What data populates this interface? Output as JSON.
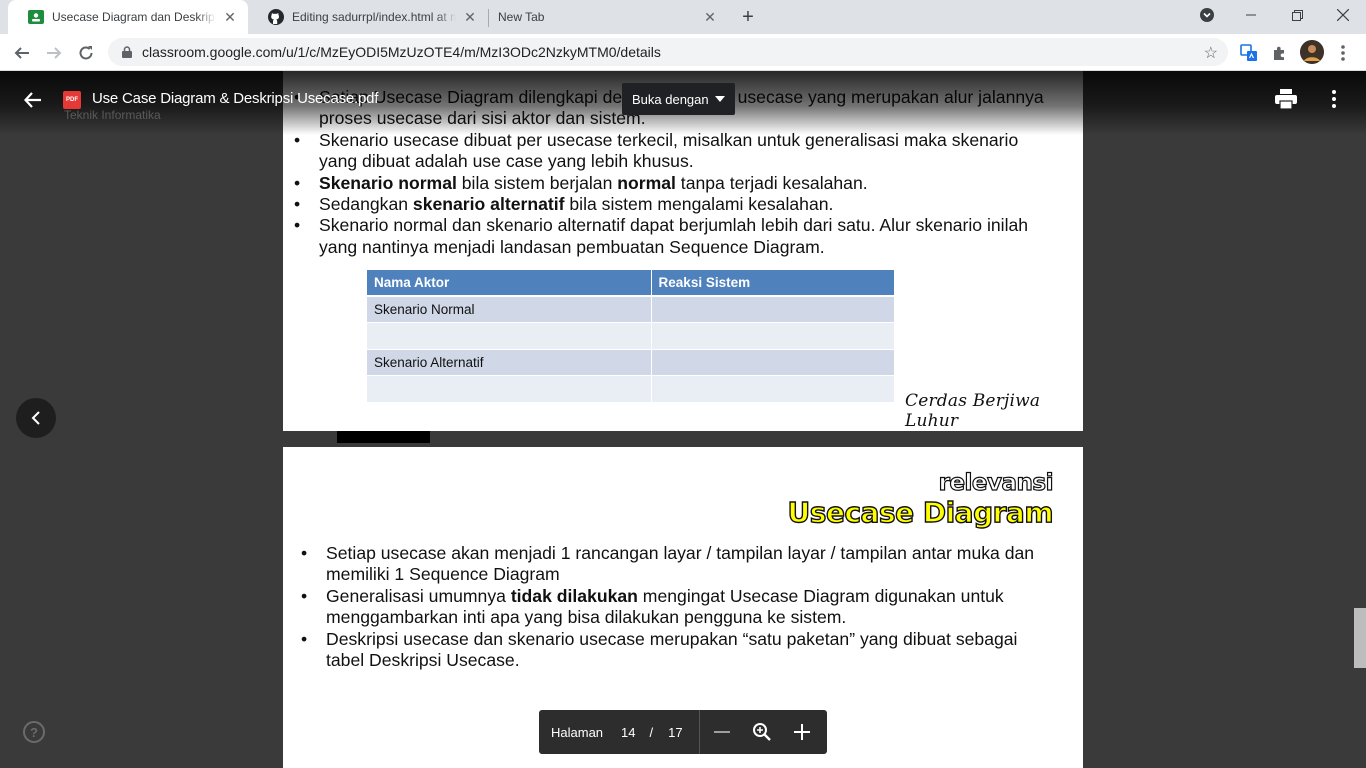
{
  "browser": {
    "tabs": [
      {
        "title": "Usecase Diagram dan Deskripsi Usecase",
        "icon": "classroom-icon"
      },
      {
        "title": "Editing sadurrpl/index.html at master",
        "icon": "github-icon"
      },
      {
        "title": "New Tab",
        "icon": ""
      }
    ],
    "url": "classroom.google.com/u/1/c/MzEyODI5MzUzOTE4/m/MzI3ODc2NzkyMTM0/details"
  },
  "viewer": {
    "file_title": "Use Case Diagram & Deskripsi Usecase.pdf",
    "subtitle": "Teknik Informatika",
    "open_with": "Buka dengan",
    "file_type_badge": "PDF"
  },
  "page1": {
    "bullets": [
      [
        {
          "t": "Setiap Usecase Diagram dilengkapi dengan skenario usecase yang merupakan alur jalannya proses usecase dari sisi aktor dan sistem.",
          "b": false
        }
      ],
      [
        {
          "t": "Skenario usecase dibuat per usecase terkecil, misalkan untuk generalisasi maka skenario yang dibuat adalah use case yang lebih khusus.",
          "b": false
        }
      ],
      [
        {
          "t": "Skenario normal",
          "b": true
        },
        {
          "t": " bila sistem berjalan ",
          "b": false
        },
        {
          "t": "normal",
          "b": true
        },
        {
          "t": " tanpa terjadi kesalahan.",
          "b": false
        }
      ],
      [
        {
          "t": "Sedangkan ",
          "b": false
        },
        {
          "t": "skenario alternatif",
          "b": true
        },
        {
          "t": " bila sistem mengalami kesalahan.",
          "b": false
        }
      ],
      [
        {
          "t": "Skenario normal dan skenario alternatif dapat berjumlah lebih dari satu. Alur skenario inilah yang nantinya menjadi landasan pembuatan Sequence Diagram.",
          "b": false
        }
      ]
    ],
    "table": {
      "headers": [
        "Nama Aktor",
        "Reaksi Sistem"
      ],
      "rows": [
        [
          "Skenario Normal",
          ""
        ],
        [
          "",
          ""
        ],
        [
          "Skenario Alternatif",
          ""
        ],
        [
          "",
          ""
        ]
      ]
    },
    "signature": "Cerdas Berjiwa Luhur"
  },
  "page2": {
    "heading_small": "relevansi",
    "heading_large": "Usecase Diagram",
    "bullets": [
      [
        {
          "t": "Setiap usecase akan menjadi 1 rancangan layar / tampilan layar / tampilan antar muka dan memiliki 1 Sequence Diagram",
          "b": false
        }
      ],
      [
        {
          "t": "Generalisasi umumnya ",
          "b": false
        },
        {
          "t": "tidak dilakukan",
          "b": true
        },
        {
          "t": " mengingat Usecase Diagram digunakan untuk menggambarkan inti apa yang bisa dilakukan pengguna ke sistem.",
          "b": false
        }
      ],
      [
        {
          "t": "Deskripsi usecase dan skenario usecase merupakan “satu paketan” yang dibuat sebagai tabel Deskripsi Usecase.",
          "b": false
        }
      ]
    ]
  },
  "pager": {
    "label": "Halaman",
    "current": "14",
    "separator": "/",
    "total": "17"
  },
  "colors": {
    "table_header": "#4f81bd",
    "table_row_dark": "#d0d8e8",
    "table_row_light": "#e9edf4",
    "heading_yellow": "#ffff00"
  }
}
